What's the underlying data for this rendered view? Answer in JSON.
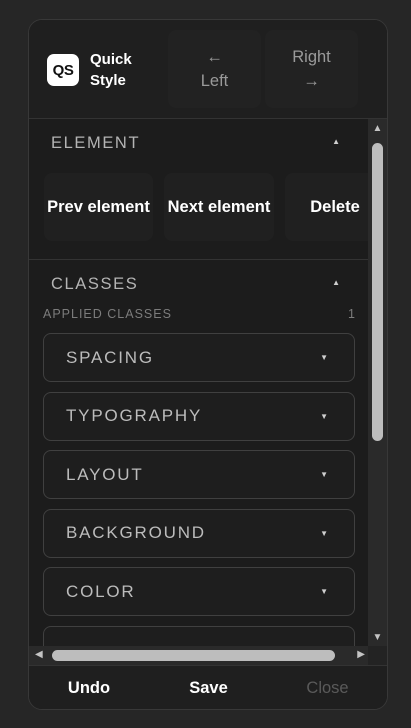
{
  "header": {
    "logo_text": "QS",
    "brand_name": "Quick Style",
    "nav_left": {
      "arrow": "←",
      "label": "Left"
    },
    "nav_right": {
      "label": "Right",
      "arrow": "→"
    }
  },
  "element_section": {
    "title": "ELEMENT",
    "caret": "▲",
    "buttons": {
      "prev": "Prev element",
      "next": "Next element",
      "delete": "Delete"
    }
  },
  "classes_section": {
    "title": "CLASSES",
    "caret": "▲",
    "applied_label": "APPLIED CLASSES",
    "applied_count": "1",
    "items": [
      {
        "label": "SPACING",
        "caret": "▼"
      },
      {
        "label": "TYPOGRAPHY",
        "caret": "▼"
      },
      {
        "label": "LAYOUT",
        "caret": "▼"
      },
      {
        "label": "BACKGROUND",
        "caret": "▼"
      },
      {
        "label": "COLOR",
        "caret": "▼"
      }
    ]
  },
  "scrollbar": {
    "up": "▲",
    "down": "▼",
    "left": "◀",
    "right": "▶"
  },
  "footer": {
    "undo": "Undo",
    "save": "Save",
    "close": "Close"
  },
  "colors": {
    "page_bg": "#262626",
    "panel_bg": "#1c1c1c",
    "text_primary": "#ffffff",
    "text_muted": "#b4b4b4",
    "text_disabled": "#5a5a5a"
  }
}
